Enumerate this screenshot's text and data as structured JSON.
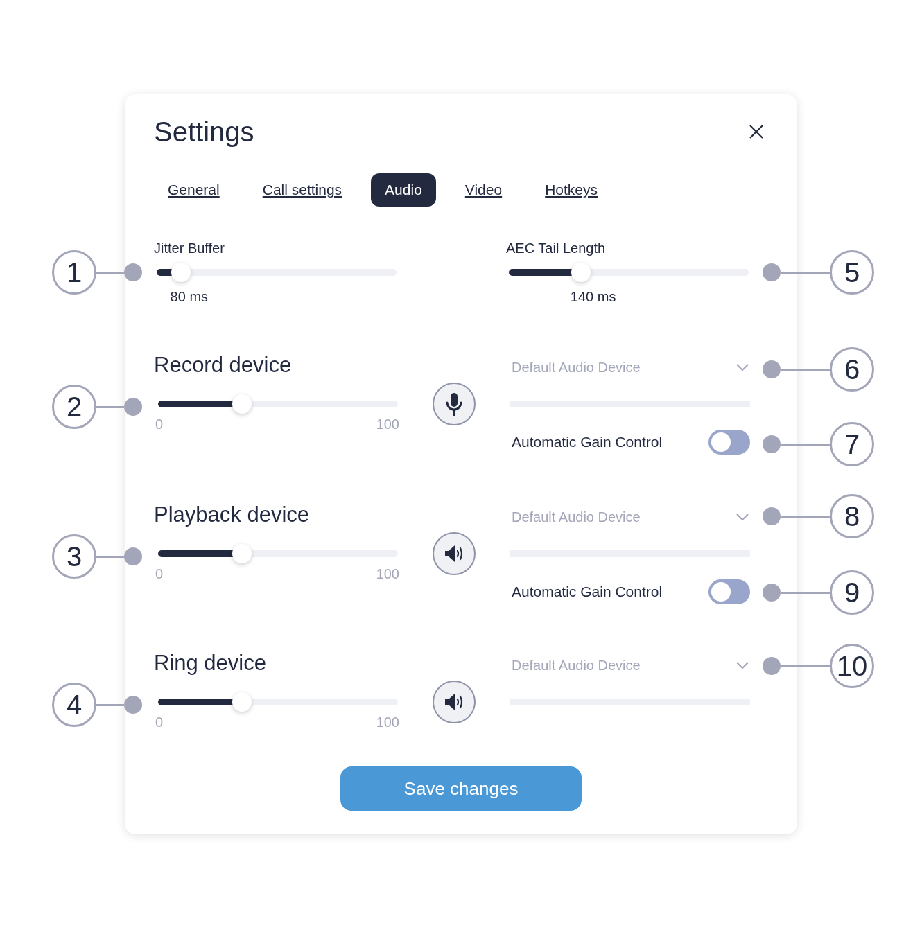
{
  "window": {
    "title": "Settings"
  },
  "tabs": [
    {
      "label": "General",
      "selected": false
    },
    {
      "label": "Call settings",
      "selected": false
    },
    {
      "label": "Audio",
      "selected": true
    },
    {
      "label": "Video",
      "selected": false
    },
    {
      "label": "Hotkeys",
      "selected": false
    }
  ],
  "buffers": [
    {
      "label": "Jitter Buffer",
      "level": 0.1,
      "reading": "80 ms"
    },
    {
      "label": "AEC Tail Length",
      "level": 0.3,
      "reading": "140 ms"
    }
  ],
  "devices": [
    {
      "title": "Record device",
      "level": 0.35,
      "min": "0",
      "max": "100",
      "kind": "microphone",
      "value": "Default Audio Device",
      "agc": {
        "label": "Automatic Gain Control",
        "on": false
      }
    },
    {
      "title": "Playback device",
      "level": 0.35,
      "min": "0",
      "max": "100",
      "kind": "speaker",
      "value": "Default Audio Device",
      "agc": {
        "label": "Automatic Gain Control",
        "on": false
      }
    },
    {
      "title": "Ring device",
      "level": 0.35,
      "min": "0",
      "max": "100",
      "kind": "speaker",
      "value": "Default Audio Device"
    }
  ],
  "save_button": "Save changes",
  "left_callouts": [
    "1",
    "2",
    "3",
    "4"
  ],
  "right_callouts": [
    "5",
    "6",
    "7",
    "8",
    "9",
    "10"
  ]
}
